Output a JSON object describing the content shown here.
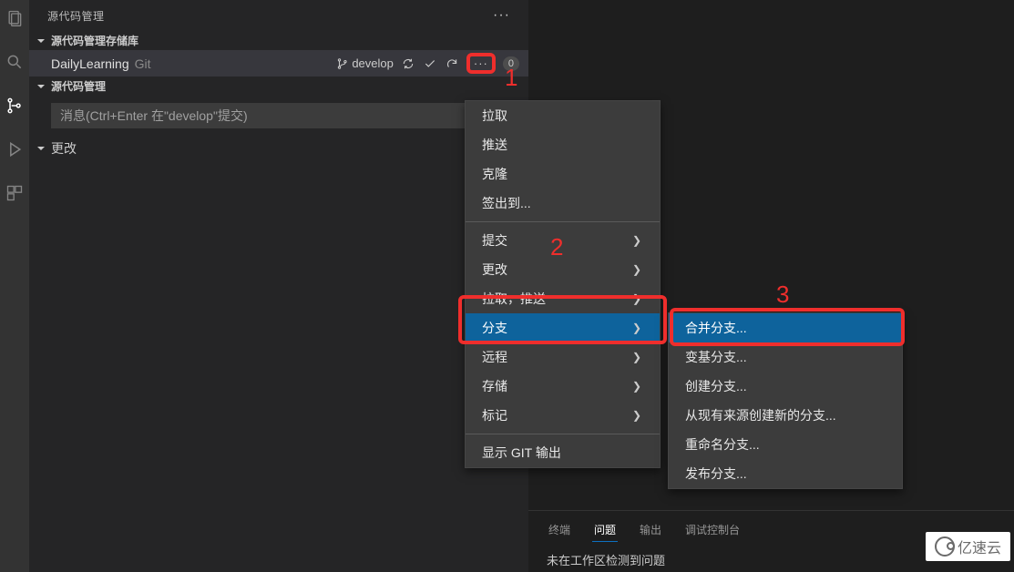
{
  "panel": {
    "title": "源代码管理",
    "repos_section": "源代码管理存储库",
    "scm_section": "源代码管理",
    "repo": {
      "name": "DailyLearning",
      "type": "Git",
      "branch": "develop",
      "count": "0"
    },
    "commit_placeholder": "消息(Ctrl+Enter 在\"develop\"提交)",
    "changes": "更改"
  },
  "menu1": {
    "pull": "拉取",
    "push": "推送",
    "clone": "克隆",
    "checkout": "签出到...",
    "commit": "提交",
    "changes": "更改",
    "pull_push": "拉取，推送",
    "branch": "分支",
    "remote": "远程",
    "stash": "存储",
    "tags": "标记",
    "show_git": "显示 GIT 输出"
  },
  "menu2": {
    "merge": "合并分支...",
    "rebase": "变基分支...",
    "create": "创建分支...",
    "create_from": "从现有来源创建新的分支...",
    "rename": "重命名分支...",
    "publish": "发布分支..."
  },
  "annotations": {
    "n1": "1",
    "n2": "2",
    "n3": "3"
  },
  "bottom": {
    "terminal": "终端",
    "problems": "问题",
    "output": "输出",
    "debug_console": "调试控制台",
    "msg": "未在工作区检测到问题"
  },
  "watermark": "亿速云"
}
